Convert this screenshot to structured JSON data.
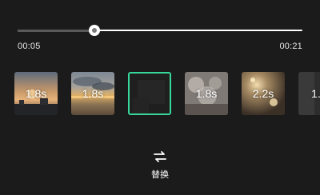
{
  "player": {
    "current_time": "00:05",
    "total_time": "00:21",
    "progress": 0.271,
    "accent_color": "#37d79b"
  },
  "clips": [
    {
      "duration": "1.8s",
      "scene": "sunset-over-city"
    },
    {
      "duration": "1.8s",
      "scene": "sunset-clouds-over-water"
    },
    {
      "duration": "",
      "scene": "dark-night-scene",
      "selected": true,
      "icon": "edit-icon"
    },
    {
      "duration": "1.8s",
      "scene": "fireworks-sparks"
    },
    {
      "duration": "2.2s",
      "scene": "sparklers-night"
    },
    {
      "duration": "1.",
      "scene": "dark-partial-clip"
    }
  ],
  "actions": {
    "replace_label": "替换",
    "replace_icon": "swap-icon"
  }
}
